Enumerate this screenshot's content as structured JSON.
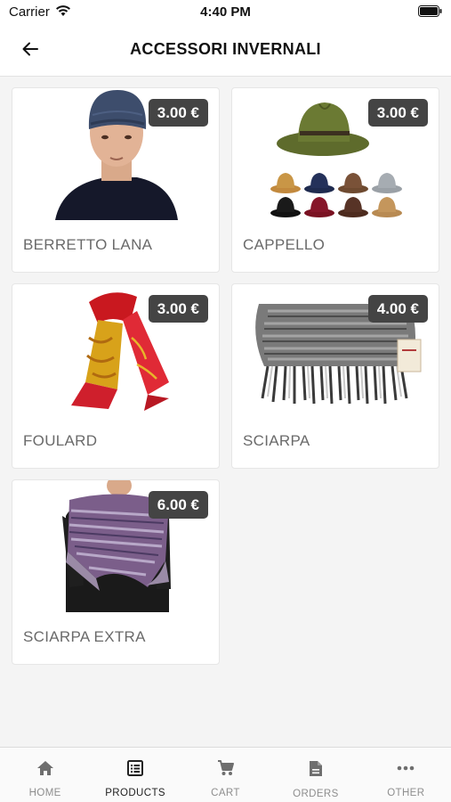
{
  "status_bar": {
    "carrier": "Carrier",
    "time": "4:40 PM"
  },
  "header": {
    "title": "ACCESSORI INVERNALI",
    "back_icon": "arrow-left-icon"
  },
  "products": [
    {
      "name": "BERRETTO LANA",
      "price": "3.00 €",
      "image": "beanie-man-image"
    },
    {
      "name": "CAPPELLO",
      "price": "3.00 €",
      "image": "fedora-hats-image"
    },
    {
      "name": "FOULARD",
      "price": "3.00 €",
      "image": "silk-foulard-image"
    },
    {
      "name": "SCIARPA",
      "price": "4.00 €",
      "image": "wool-scarf-image"
    },
    {
      "name": "SCIARPA EXTRA",
      "price": "6.00 €",
      "image": "shawl-woman-image"
    }
  ],
  "tabs": [
    {
      "label": "HOME",
      "icon": "home-icon",
      "active": false
    },
    {
      "label": "PRODUCTS",
      "icon": "list-icon",
      "active": true
    },
    {
      "label": "CART",
      "icon": "cart-icon",
      "active": false
    },
    {
      "label": "ORDERS",
      "icon": "document-icon",
      "active": false
    },
    {
      "label": "OTHER",
      "icon": "more-icon",
      "active": false
    }
  ],
  "colors": {
    "badge": "#444444",
    "product_name": "#6a6a6a",
    "tab_active": "#222222",
    "tab_inactive": "#8e8e8e"
  }
}
